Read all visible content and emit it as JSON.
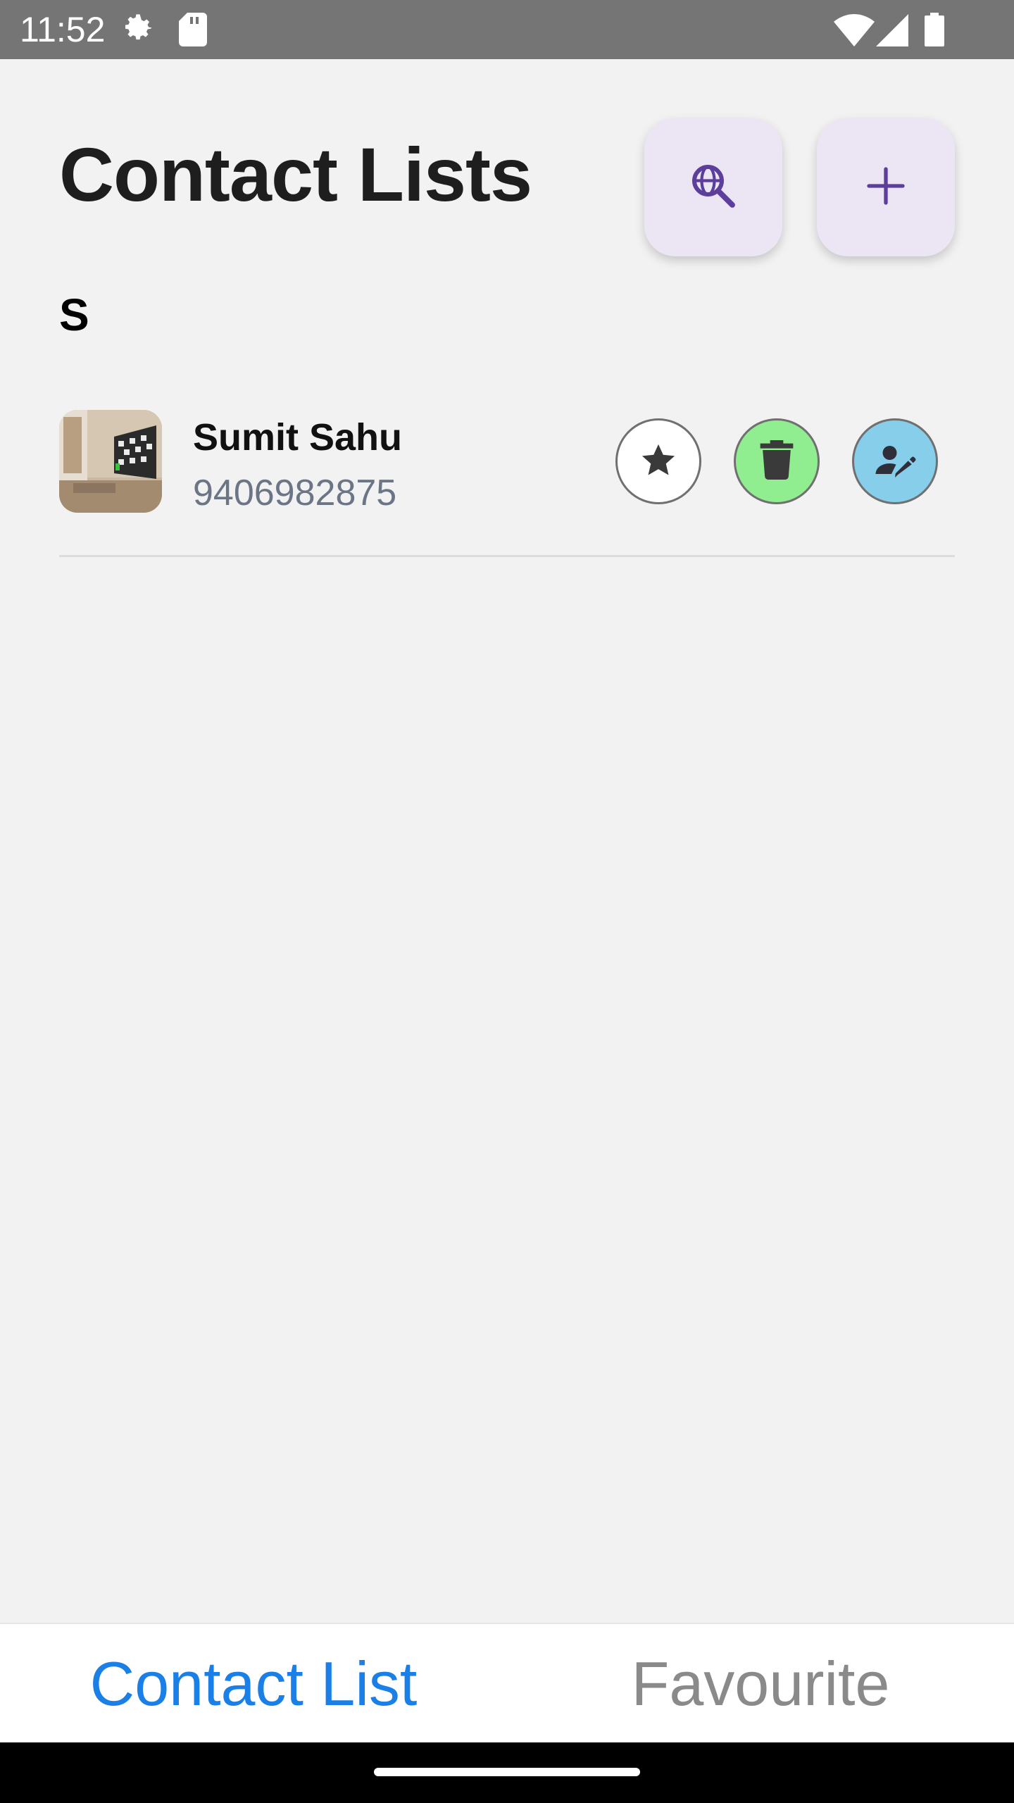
{
  "status_bar": {
    "time": "11:52",
    "icons": [
      "gear-icon",
      "sd-card-icon",
      "wifi-icon",
      "signal-icon",
      "battery-icon"
    ]
  },
  "header": {
    "title": "Contact Lists",
    "buttons": [
      "globe-search-icon",
      "plus-icon"
    ],
    "accent_color": "#5b3f9a",
    "button_bg": "#ece6f4"
  },
  "sections": [
    {
      "letter": "S",
      "contacts": [
        {
          "name": "Sumit Sahu",
          "phone": "9406982875",
          "actions": [
            {
              "icon": "star-icon",
              "color": "#ffffff"
            },
            {
              "icon": "trash-icon",
              "color": "#90ee90"
            },
            {
              "icon": "edit-user-icon",
              "color": "#87ceeb"
            }
          ]
        }
      ]
    }
  ],
  "bottom_tabs": {
    "items": [
      "Contact List",
      "Favourite"
    ],
    "active": "Contact List",
    "active_color": "#1a7fe6",
    "inactive_color": "#8a8a8a"
  }
}
